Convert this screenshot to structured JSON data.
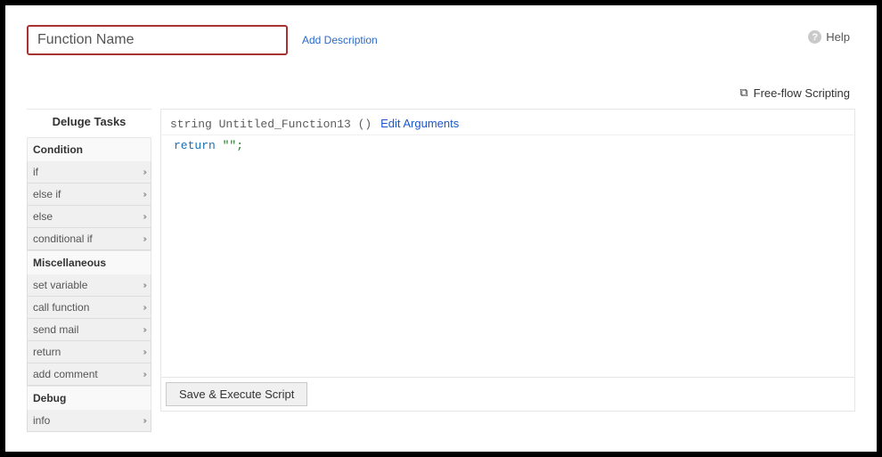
{
  "header": {
    "function_name_placeholder": "Function Name",
    "add_description": "Add Description",
    "help_label": "Help",
    "freeflow_label": "Free-flow Scripting"
  },
  "sidebar": {
    "title": "Deluge Tasks",
    "groups": [
      {
        "label": "Condition",
        "items": [
          "if",
          "else if",
          "else",
          "conditional if"
        ]
      },
      {
        "label": "Miscellaneous",
        "items": [
          "set variable",
          "call function",
          "send mail",
          "return",
          "add comment"
        ]
      },
      {
        "label": "Debug",
        "items": [
          "info"
        ]
      }
    ]
  },
  "editor": {
    "signature_prefix": "string Untitled_Function13 ()",
    "edit_arguments": "Edit Arguments",
    "code_keyword": "return",
    "code_rest": " \"\";",
    "save_execute": "Save & Execute Script"
  }
}
